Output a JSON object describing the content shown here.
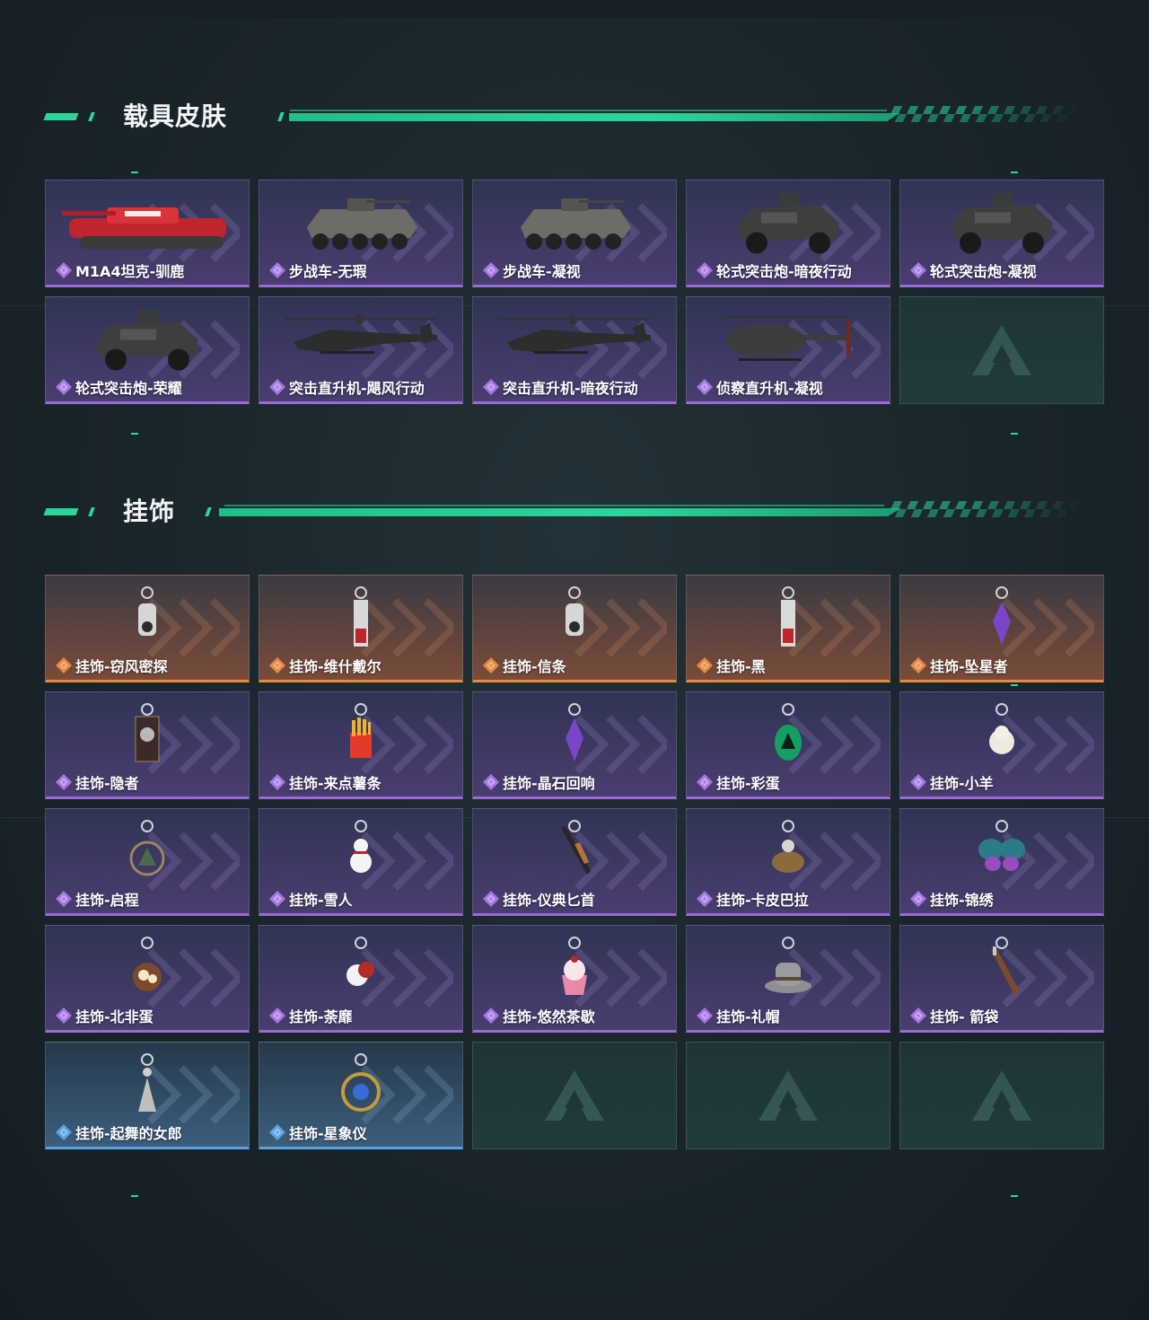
{
  "sections": {
    "vehicles": {
      "title": "载具皮肤",
      "items": [
        {
          "label": "M1A4坦克-驯鹿",
          "rarity": "purple",
          "icon": "tank-icon"
        },
        {
          "label": "步战车-无瑕",
          "rarity": "purple",
          "icon": "ifv-icon"
        },
        {
          "label": "步战车-凝视",
          "rarity": "purple",
          "icon": "ifv-icon"
        },
        {
          "label": "轮式突击炮-暗夜行动",
          "rarity": "purple",
          "icon": "armored-car-icon"
        },
        {
          "label": "轮式突击炮-凝视",
          "rarity": "purple",
          "icon": "armored-car-icon"
        },
        {
          "label": "轮式突击炮-荣耀",
          "rarity": "purple",
          "icon": "armored-car-icon"
        },
        {
          "label": "突击直升机-飓风行动",
          "rarity": "purple",
          "icon": "attack-helicopter-icon"
        },
        {
          "label": "突击直升机-暗夜行动",
          "rarity": "purple",
          "icon": "attack-helicopter-icon"
        },
        {
          "label": "侦察直升机-凝视",
          "rarity": "purple",
          "icon": "scout-helicopter-icon"
        },
        {
          "label": "",
          "rarity": "empty",
          "icon": "emblem-icon"
        }
      ]
    },
    "charms": {
      "title": "挂饰",
      "items": [
        {
          "label": "挂饰-窃风密探",
          "rarity": "orange",
          "icon": "charm-icon"
        },
        {
          "label": "挂饰-维什戴尔",
          "rarity": "orange",
          "icon": "charm-tag-icon"
        },
        {
          "label": "挂饰-信条",
          "rarity": "orange",
          "icon": "charm-icon"
        },
        {
          "label": "挂饰-黑",
          "rarity": "orange",
          "icon": "charm-tag-icon"
        },
        {
          "label": "挂饰-坠星者",
          "rarity": "orange",
          "icon": "charm-crystal-icon"
        },
        {
          "label": "挂饰-隐者",
          "rarity": "purple",
          "icon": "charm-card-icon"
        },
        {
          "label": "挂饰-来点薯条",
          "rarity": "purple",
          "icon": "charm-fries-icon"
        },
        {
          "label": "挂饰-晶石回响",
          "rarity": "purple",
          "icon": "charm-crystal-icon"
        },
        {
          "label": "挂饰-彩蛋",
          "rarity": "purple",
          "icon": "charm-egg-icon"
        },
        {
          "label": "挂饰-小羊",
          "rarity": "purple",
          "icon": "charm-sheep-icon"
        },
        {
          "label": "挂饰-启程",
          "rarity": "purple",
          "icon": "charm-medal-icon"
        },
        {
          "label": "挂饰-雪人",
          "rarity": "purple",
          "icon": "charm-snowman-icon"
        },
        {
          "label": "挂饰-仪典匕首",
          "rarity": "purple",
          "icon": "charm-dagger-icon"
        },
        {
          "label": "挂饰-卡皮巴拉",
          "rarity": "purple",
          "icon": "charm-capybara-icon"
        },
        {
          "label": "挂饰-锦绣",
          "rarity": "purple",
          "icon": "charm-butterfly-icon"
        },
        {
          "label": "挂饰-北非蛋",
          "rarity": "purple",
          "icon": "charm-food-icon"
        },
        {
          "label": "挂饰-荼靡",
          "rarity": "purple",
          "icon": "charm-flower-icon"
        },
        {
          "label": "挂饰-悠然茶歇",
          "rarity": "purple",
          "icon": "charm-cupcake-icon"
        },
        {
          "label": "挂饰-礼帽",
          "rarity": "purple",
          "icon": "charm-hat-icon"
        },
        {
          "label": "挂饰- 箭袋",
          "rarity": "purple",
          "icon": "charm-quiver-icon"
        },
        {
          "label": "挂饰-起舞的女郎",
          "rarity": "blue",
          "icon": "charm-dancer-icon"
        },
        {
          "label": "挂饰-星象仪",
          "rarity": "blue",
          "icon": "charm-orrery-icon"
        },
        {
          "label": "",
          "rarity": "empty",
          "icon": "emblem-icon"
        },
        {
          "label": "",
          "rarity": "empty",
          "icon": "emblem-icon"
        },
        {
          "label": "",
          "rarity": "empty",
          "icon": "emblem-icon"
        }
      ]
    }
  },
  "colors": {
    "accent": "#2ad79a",
    "purple": "#9a6ad8",
    "orange": "#e38a45",
    "blue": "#5aa3e0"
  }
}
